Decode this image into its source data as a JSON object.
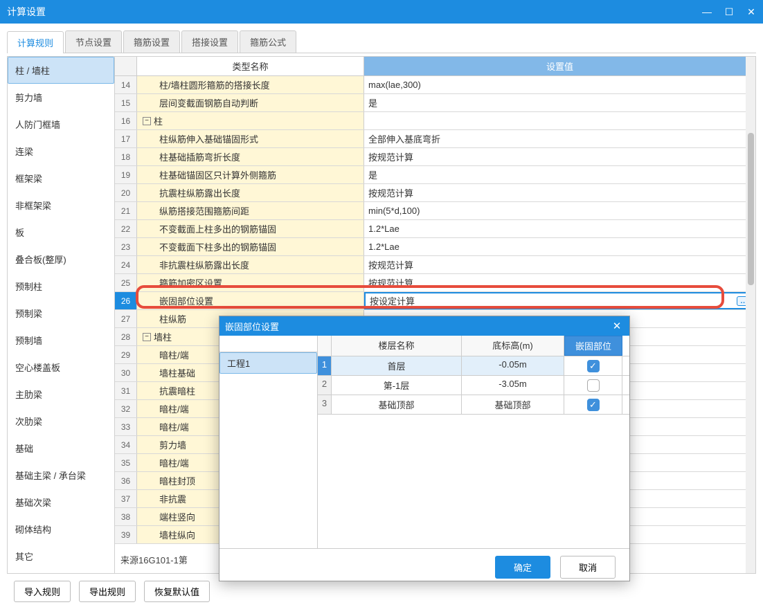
{
  "window": {
    "title": "计算设置"
  },
  "tabs": [
    "计算规则",
    "节点设置",
    "箍筋设置",
    "搭接设置",
    "箍筋公式"
  ],
  "activeTab": 0,
  "sidebar": {
    "items": [
      "柱 / 墙柱",
      "剪力墙",
      "人防门框墙",
      "连梁",
      "框架梁",
      "非框架梁",
      "板",
      "叠合板(整厚)",
      "预制柱",
      "预制梁",
      "预制墙",
      "空心楼盖板",
      "主肋梁",
      "次肋梁",
      "基础",
      "基础主梁 / 承台梁",
      "基础次梁",
      "砌体结构",
      "其它"
    ],
    "selected": 0
  },
  "gridHeaders": {
    "name": "类型名称",
    "value": "设置值"
  },
  "rows": [
    {
      "n": 14,
      "indent": 1,
      "name": "柱/墙柱圆形箍筋的搭接长度",
      "val": "max(lae,300)"
    },
    {
      "n": 15,
      "indent": 1,
      "name": "层间变截面钢筋自动判断",
      "val": "是"
    },
    {
      "n": 16,
      "indent": 0,
      "group": true,
      "name": "柱",
      "val": ""
    },
    {
      "n": 17,
      "indent": 1,
      "name": "柱纵筋伸入基础锚固形式",
      "val": "全部伸入基底弯折"
    },
    {
      "n": 18,
      "indent": 1,
      "name": "柱基础插筋弯折长度",
      "val": "按规范计算"
    },
    {
      "n": 19,
      "indent": 1,
      "name": "柱基础锚固区只计算外侧箍筋",
      "val": "是"
    },
    {
      "n": 20,
      "indent": 1,
      "name": "抗震柱纵筋露出长度",
      "val": "按规范计算"
    },
    {
      "n": 21,
      "indent": 1,
      "name": "纵筋搭接范围箍筋间距",
      "val": "min(5*d,100)"
    },
    {
      "n": 22,
      "indent": 1,
      "name": "不变截面上柱多出的钢筋锚固",
      "val": "1.2*Lae"
    },
    {
      "n": 23,
      "indent": 1,
      "name": "不变截面下柱多出的钢筋锚固",
      "val": "1.2*Lae"
    },
    {
      "n": 24,
      "indent": 1,
      "name": "非抗震柱纵筋露出长度",
      "val": "按规范计算"
    },
    {
      "n": 25,
      "indent": 1,
      "name": "箍筋加密区设置",
      "val": "按规范计算"
    },
    {
      "n": 26,
      "indent": 1,
      "name": "嵌固部位设置",
      "val": "按设定计算",
      "hl": true,
      "cellbtn": true
    },
    {
      "n": 27,
      "indent": 1,
      "name": "柱纵筋",
      "val": ""
    },
    {
      "n": 28,
      "indent": 0,
      "group": true,
      "name": "墙柱",
      "val": ""
    },
    {
      "n": 29,
      "indent": 1,
      "name": "暗柱/端",
      "val": ""
    },
    {
      "n": 30,
      "indent": 1,
      "name": "墙柱基础",
      "val": ""
    },
    {
      "n": 31,
      "indent": 1,
      "name": "抗震暗柱",
      "val": ""
    },
    {
      "n": 32,
      "indent": 1,
      "name": "暗柱/端",
      "val": ""
    },
    {
      "n": 33,
      "indent": 1,
      "name": "暗柱/端",
      "val": ""
    },
    {
      "n": 34,
      "indent": 1,
      "name": "剪力墙",
      "val": ""
    },
    {
      "n": 35,
      "indent": 1,
      "name": "暗柱/端",
      "val": ""
    },
    {
      "n": 36,
      "indent": 1,
      "name": "暗柱封顶",
      "val": ""
    },
    {
      "n": 37,
      "indent": 1,
      "name": "非抗震",
      "val": ""
    },
    {
      "n": 38,
      "indent": 1,
      "name": "端柱竖向",
      "val": ""
    },
    {
      "n": 39,
      "indent": 1,
      "name": "墙柱纵向",
      "val": ""
    }
  ],
  "source": "来源16G101-1第",
  "bottomButtons": {
    "import": "导入规则",
    "export": "导出规则",
    "reset": "恢复默认值"
  },
  "dialog": {
    "title": "嵌固部位设置",
    "project": "工程1",
    "headers": {
      "floor": "楼层名称",
      "elev": "底标高(m)",
      "pos": "嵌固部位"
    },
    "rows": [
      {
        "i": "1",
        "floor": "首层",
        "elev": "-0.05m",
        "chk": true,
        "sel": true
      },
      {
        "i": "2",
        "floor": "第-1层",
        "elev": "-3.05m",
        "chk": false
      },
      {
        "i": "3",
        "floor": "基础顶部",
        "elev": "基础顶部",
        "chk": true
      }
    ],
    "ok": "确定",
    "cancel": "取消"
  }
}
